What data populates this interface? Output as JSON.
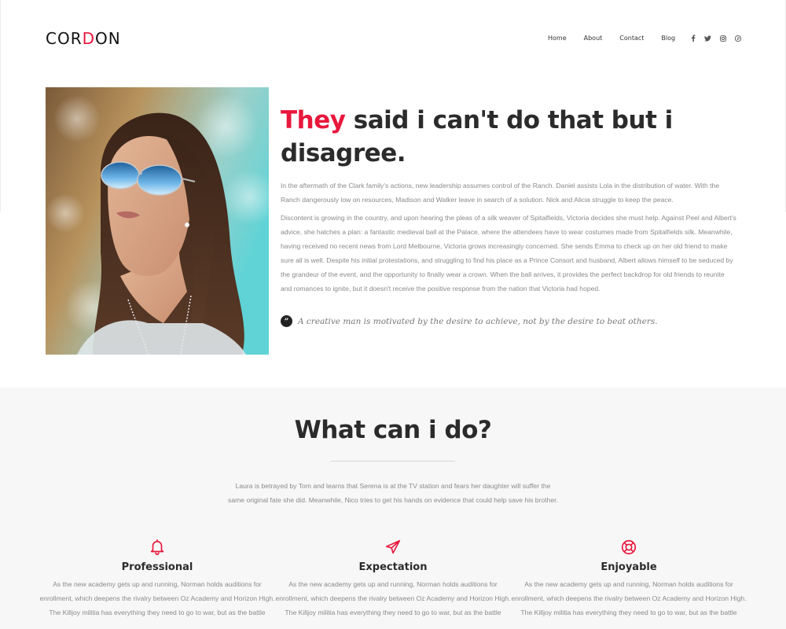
{
  "brand": {
    "logo_left": "COR",
    "logo_d": "D",
    "logo_right": "ON"
  },
  "nav": {
    "items": [
      "Home",
      "About",
      "Contact",
      "Blog"
    ]
  },
  "social": {
    "icons": [
      "facebook-icon",
      "twitter-icon",
      "instagram-icon",
      "pinterest-icon"
    ]
  },
  "hero": {
    "title_accent": "They",
    "title_rest": " said i can't do that but i disagree.",
    "paragraph1": "In the aftermath of the Clark family's actions, new leadership assumes control of the Ranch. Daniel assists Lola in the distribution of water. With the Ranch dangerously low on resources, Madison and Walker leave in search of a solution. Nick and Alicia struggle to keep the peace.",
    "paragraph2": "Discontent is growing in the country, and upon hearing the pleas of a silk weaver of Spitalfields, Victoria decides she must help. Against Peel and Albert's advice, she hatches a plan: a fantastic medieval ball at the Palace, where the attendees have to wear costumes made from Spitalfields silk. Meanwhile, having received no recent news from Lord Melbourne, Victoria grows increasingly concerned. She sends Emma to check up on her old friend to make sure all is well. Despite his initial protestations, and struggling to find his place as a Prince Consort and husband, Albert allows himself to be seduced by the grandeur of the event, and the opportunity to finally wear a crown. When the ball arrives, it provides the perfect backdrop for old friends to reunite and romances to ignite, but it doesn't receive the positive response from the nation that Victoria had hoped.",
    "quote_glyph": "”",
    "quote": "A creative man is motivated by the desire to achieve, not by the desire to beat others."
  },
  "services": {
    "title": "What can i do?",
    "description": "Laura is betrayed by Tom and learns that Serena is at the TV station and fears her daughter will suffer the same original fate she did. Meanwhile, Nico tries to get his hands on evidence that could help save his brother.",
    "accent_color": "#e8173c",
    "features": [
      {
        "icon": "bell-icon",
        "title": "Professional",
        "text": "As the new academy gets up and running, Norman holds auditions for enrollment, which deepens the rivalry between Oz Academy and Horizon High. The Killjoy militia has everything they need to go to war, but as the battle"
      },
      {
        "icon": "paper-plane-icon",
        "title": "Expectation",
        "text": "As the new academy gets up and running, Norman holds auditions for enrollment, which deepens the rivalry between Oz Academy and Horizon High. The Killjoy militia has everything they need to go to war, but as the battle"
      },
      {
        "icon": "life-ring-icon",
        "title": "Enjoyable",
        "text": "As the new academy gets up and running, Norman holds auditions for enrollment, which deepens the rivalry between Oz Academy and Horizon High. The Killjoy militia has everything they need to go to war, but as the battle"
      }
    ]
  }
}
